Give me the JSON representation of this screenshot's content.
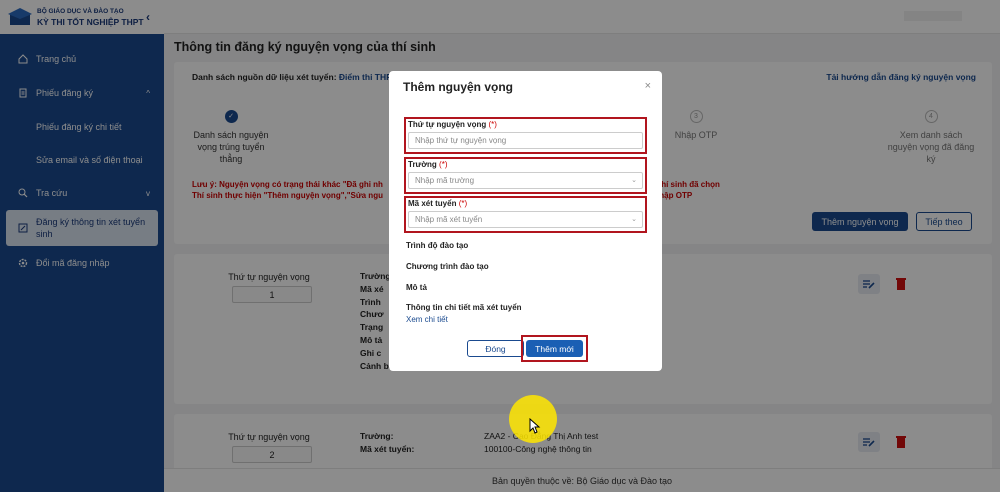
{
  "brand": {
    "sub": "BỘ GIÁO DỤC VÀ ĐÀO TẠO",
    "main": "KỲ THI TỐT NGHIỆP THPT",
    "collapse": "‹"
  },
  "sidebar": {
    "items": [
      {
        "label": "Trang chủ",
        "icon": "home-icon"
      },
      {
        "label": "Phiếu đăng ký",
        "icon": "document-icon",
        "chevron": "^"
      },
      {
        "label": "Phiếu đăng ký chi tiết"
      },
      {
        "label": "Sửa email và số điện thoại"
      },
      {
        "label": "Tra cứu",
        "icon": "search-icon",
        "chevron": "v"
      },
      {
        "label": "Đăng ký thông tin xét tuyển sinh",
        "icon": "edit-icon"
      },
      {
        "label": "Đổi mã đăng nhập",
        "icon": "gear-icon"
      }
    ]
  },
  "page": {
    "title": "Thông tin đăng ký nguyện vọng của thí sinh",
    "source_label": "Danh sách nguồn dữ liệu xét tuyển:",
    "source_value": "Điểm thi THPT",
    "guide_link": "Tải hướng dẫn đăng ký nguyện vọng",
    "steps": [
      {
        "label": "Danh sách nguyện vọng trúng tuyển thẳng",
        "dot": "✓"
      },
      {
        "label": "Nhập OTP",
        "dot": "3"
      },
      {
        "label": "Xem danh sách nguyện vọng đã đăng ký",
        "dot": "4"
      }
    ],
    "notice_1": "Lưu ý: Nguyện vọng có trạng thái khác \"Đã ghi nh                                                                                      nh sách nguyện vọng thí sinh đã chọn",
    "notice_2": "Thí sinh thực hiện \"Thêm nguyện vọng\",\"Sửa ngu                                                                                                          tới bước nhập OTP",
    "add_button": "Thêm nguyện vọng",
    "next_button": "Tiếp theo"
  },
  "rows": [
    {
      "order_label": "Thứ tự nguyện vọng",
      "order_value": "1",
      "fields": [
        "Trường:",
        "Mã xé",
        "Trình",
        "Chươ",
        "Trạng",
        "Mô tả",
        "Ghi c",
        "Cảnh báo:"
      ]
    },
    {
      "order_label": "Thứ tự nguyện vọng",
      "order_value": "2",
      "fields": [
        {
          "k": "Trường:",
          "v": "ZAA2 - Cao Đẳng Thị Anh test"
        },
        {
          "k": "Mã xét tuyển:",
          "v": "100100-Công nghệ thông tin"
        }
      ]
    }
  ],
  "footer": "Bản quyền thuộc về: Bộ Giáo dục và Đào tạo",
  "modal": {
    "title": "Thêm nguyện vọng",
    "close": "×",
    "order_label": "Thứ tự nguyện vọng",
    "order_placeholder": "Nhập thứ tự nguyện vọng",
    "school_label": "Trường",
    "school_placeholder": "Nhập mã trường",
    "code_label": "Mã xét tuyển",
    "code_placeholder": "Nhập mã xét tuyển",
    "required_mark": "(*)",
    "level_label": "Trình độ đào tạo",
    "program_label": "Chương trình đào tạo",
    "desc_label": "Mô tả",
    "detail_label": "Thông tin chi tiết mã xét tuyển",
    "detail_link": "Xem chi tiết",
    "close_button": "Đóng",
    "add_button": "Thêm mới"
  },
  "colors": {
    "primary": "#1a4a8f",
    "highlight": "#b1151e",
    "notice": "#cc0000"
  }
}
